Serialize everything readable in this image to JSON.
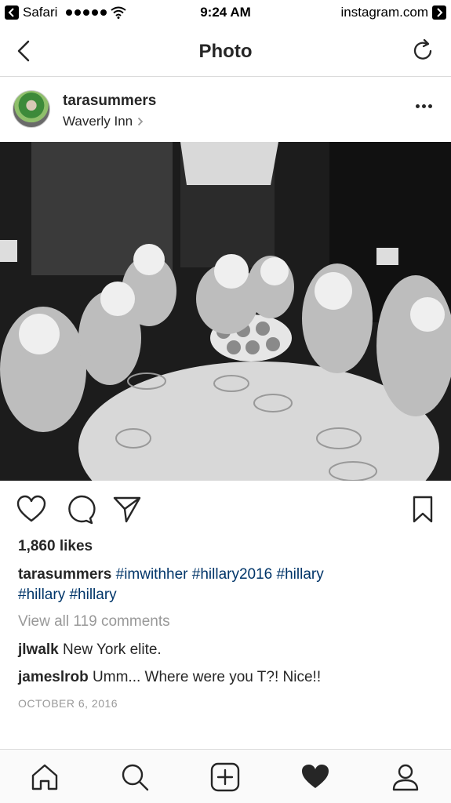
{
  "status_bar": {
    "back_app": "Safari",
    "time": "9:24 AM",
    "forward_app": "instagram.com"
  },
  "nav": {
    "title": "Photo"
  },
  "post": {
    "username": "tarasummers",
    "location": "Waverly Inn",
    "likes": "1,860 likes",
    "caption_user": "tarasummers",
    "hashtags": [
      "#imwithher",
      "#hillary2016",
      "#hillary",
      "#hillary",
      "#hillary"
    ],
    "view_all": "View all 119 comments",
    "comments": [
      {
        "user": "jlwalk",
        "text": "New York elite."
      },
      {
        "user": "jameslrob",
        "text": "Umm... Where were you T?! Nice!!"
      }
    ],
    "date": "OCTOBER 6, 2016"
  },
  "icons": {
    "nav_back": "chevron-left-icon",
    "refresh": "refresh-icon",
    "more": "more-horizontal-icon",
    "like": "heart-outline-icon",
    "comment": "comment-bubble-icon",
    "share": "paper-plane-icon",
    "bookmark": "bookmark-icon",
    "tabs": [
      "home-icon",
      "search-icon",
      "add-post-icon",
      "activity-heart-icon",
      "profile-icon"
    ]
  }
}
